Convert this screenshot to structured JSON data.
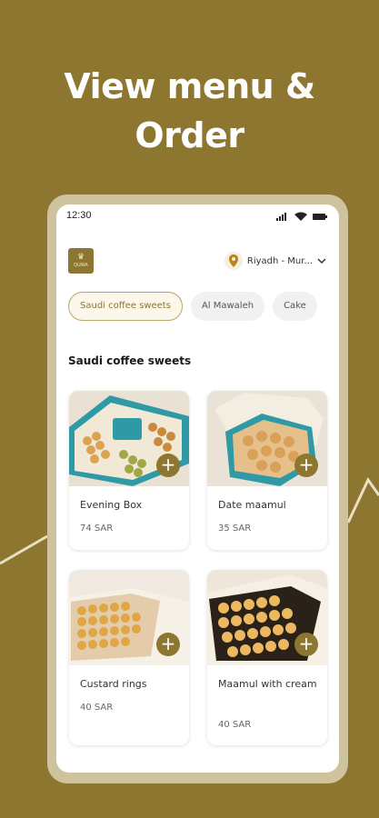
{
  "headline": {
    "line1": "View menu &",
    "line2": "Order"
  },
  "status_bar": {
    "time": "12:30"
  },
  "header": {
    "location": "Riyadh - Mur...",
    "logo_text": "QUWA"
  },
  "categories": [
    {
      "label": "Saudi coffee sweets",
      "active": true
    },
    {
      "label": "Al Mawaleh",
      "active": false
    },
    {
      "label": "Cake",
      "active": false
    }
  ],
  "section_title": "Saudi coffee sweets",
  "products": [
    {
      "name": "Evening Box",
      "price": "74 SAR",
      "add_icon": "plus-icon"
    },
    {
      "name": "Date maamul",
      "price": "35 SAR",
      "add_icon": "plus-icon"
    },
    {
      "name": "Custard rings",
      "price": "40 SAR",
      "add_icon": "plus-icon"
    },
    {
      "name": "Maamul with cream",
      "price": "40 SAR",
      "add_icon": "plus-icon"
    }
  ],
  "colors": {
    "brand": "#8d7630",
    "frame": "#cfc39d",
    "teal_box": "#2f9aa6",
    "background_card": "#ffffff"
  }
}
